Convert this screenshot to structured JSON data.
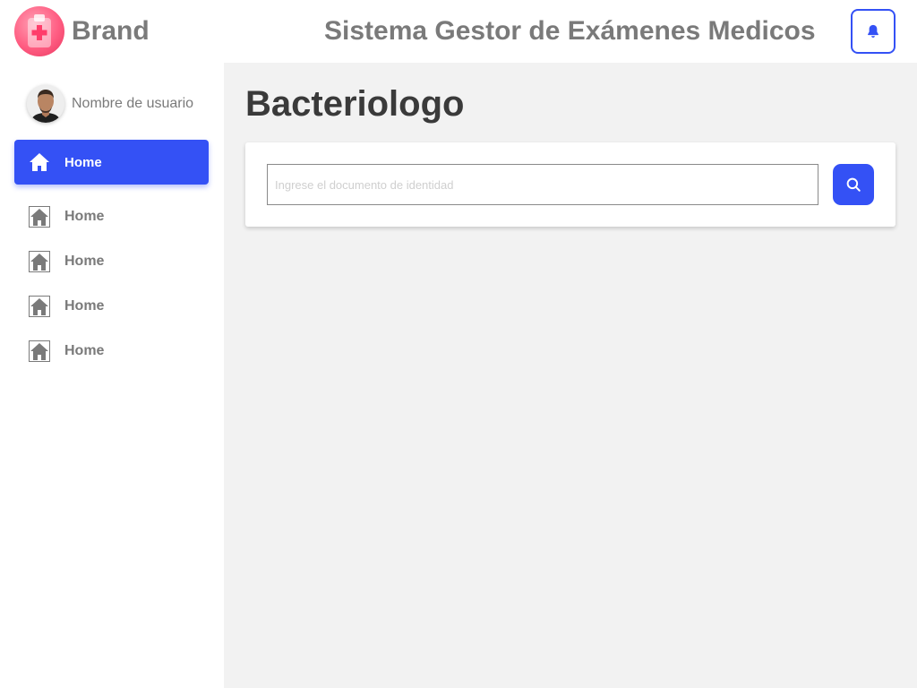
{
  "header": {
    "brand": "Brand",
    "title": "Sistema Gestor de Exámenes Medicos",
    "notification_icon": "bell-icon"
  },
  "sidebar": {
    "user": {
      "name": "Nombre de usuario",
      "avatar": "user-avatar"
    },
    "items": [
      {
        "label": "Home",
        "icon": "home-icon",
        "active": true
      },
      {
        "label": "Home",
        "icon": "home-icon",
        "active": false
      },
      {
        "label": "Home",
        "icon": "home-icon",
        "active": false
      },
      {
        "label": "Home",
        "icon": "home-icon",
        "active": false
      },
      {
        "label": "Home",
        "icon": "home-icon",
        "active": false
      }
    ]
  },
  "main": {
    "page_title": "Bacteriologo",
    "search": {
      "placeholder": "Ingrese el documento de identidad",
      "value": "",
      "button_icon": "search-icon"
    }
  },
  "colors": {
    "accent": "#3451f5",
    "brand_logo": "#ff5d82",
    "main_background": "#f2f2f2",
    "text_muted": "#7a7a7a",
    "title_text": "#3a3a3a"
  }
}
